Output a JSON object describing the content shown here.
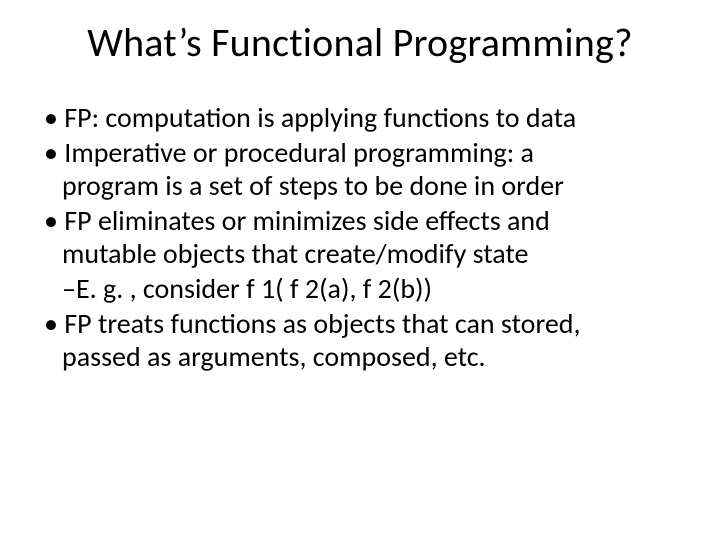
{
  "title": "What’s Functional Programming?",
  "bullets": {
    "b1": {
      "mark": "• ",
      "line1": "FP: computation is applying functions to data"
    },
    "b2": {
      "mark": "• ",
      "line1": "Imperative or procedural programming: a",
      "line2": "program is a set of steps to be done in order"
    },
    "b3": {
      "mark": "• ",
      "line1": "FP eliminates or minimizes side effects and",
      "line2": "mutable objects that create/modify state"
    },
    "b3s": {
      "mark": "–",
      "line1": "E. g. , consider f 1( f 2(a), f 2(b))"
    },
    "b4": {
      "mark": "• ",
      "line1": "FP treats functions as objects that can stored,",
      "line2": "passed as arguments, composed, etc."
    }
  }
}
